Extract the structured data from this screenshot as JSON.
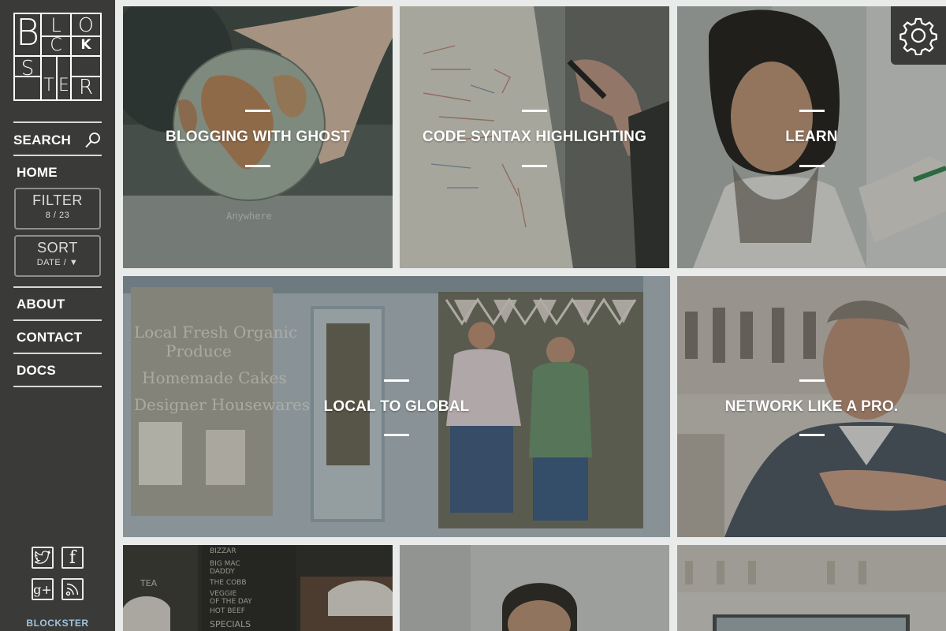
{
  "logo": {
    "letters": [
      "B",
      "L",
      "O",
      "C",
      "K",
      "S",
      "T",
      "E",
      "R"
    ]
  },
  "nav": {
    "search_label": "SEARCH",
    "home_label": "HOME",
    "filter": {
      "label": "FILTER",
      "count": "8 / 23"
    },
    "sort": {
      "label": "SORT",
      "value": "DATE / ▼"
    },
    "about_label": "ABOUT",
    "contact_label": "CONTACT",
    "docs_label": "DOCS"
  },
  "social": [
    {
      "icon": "twitter-icon"
    },
    {
      "icon": "facebook-icon",
      "glyph": "f"
    },
    {
      "icon": "google-plus-icon",
      "glyph": "g+"
    },
    {
      "icon": "rss-icon"
    }
  ],
  "brand_footer": "BLOCKSTER",
  "posts": [
    {
      "title": "BLOGGING WITH GHOST",
      "caption": "Anywhere"
    },
    {
      "title": "CODE SYNTAX HIGHLIGHTING"
    },
    {
      "title": "LEARN"
    },
    {
      "title": "LOCAL TO GLOBAL",
      "sign_lines": [
        "Local Fresh Organic",
        "Produce",
        "Homemade Cakes",
        "Designer Housewares"
      ]
    },
    {
      "title": "NETWORK LIKE A PRO."
    },
    {
      "title": ""
    },
    {
      "title": ""
    },
    {
      "title": ""
    }
  ],
  "cafe_board": {
    "lines": [
      "BIZZAR",
      "BIG MAC",
      "DADDY",
      "THE COBB",
      "VEGGIE",
      "OF THE DAY",
      "HOT BEEF",
      "SPECIALS"
    ],
    "tea": "TEA"
  },
  "colors": {
    "sidebar": "#3a3b38",
    "page": "#e9eaea",
    "accent_footer": "#9fc3e0"
  }
}
